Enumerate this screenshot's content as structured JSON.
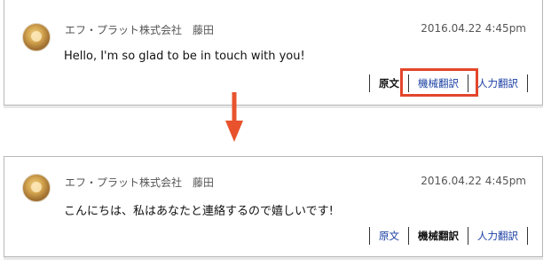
{
  "panels": [
    {
      "sender": "エフ・プラット株式会社　藤田",
      "timestamp": "2016.04.22 4:45pm",
      "message": "Hello, I'm so glad to be in touch with you!",
      "actions": {
        "original": "原文",
        "machine": "機械翻訳",
        "human": "人力翻訳"
      },
      "active": "original"
    },
    {
      "sender": "エフ・プラット株式会社　藤田",
      "timestamp": "2016.04.22 4:45pm",
      "message": "こんにちは、私はあなたと連絡するので嬉しいです!",
      "actions": {
        "original": "原文",
        "machine": "機械翻訳",
        "human": "人力翻訳"
      },
      "active": "machine"
    }
  ],
  "colors": {
    "highlight": "#e3462b",
    "arrow": "#e8522c",
    "link": "#1a3fa3"
  }
}
